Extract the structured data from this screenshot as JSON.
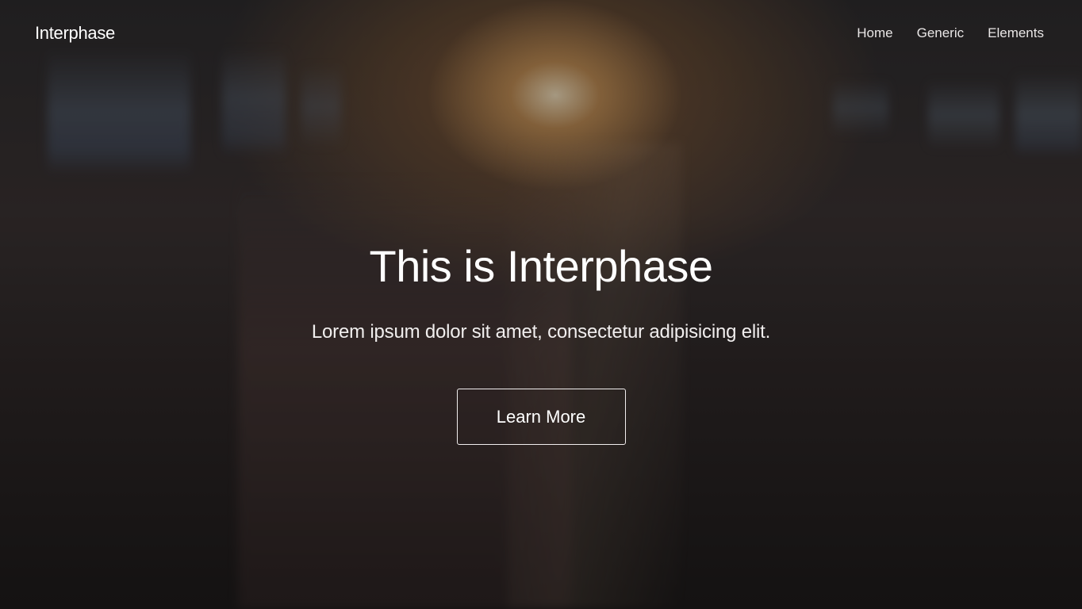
{
  "header": {
    "logo": "Interphase",
    "nav": [
      {
        "label": "Home"
      },
      {
        "label": "Generic"
      },
      {
        "label": "Elements"
      }
    ]
  },
  "hero": {
    "title": "This is Interphase",
    "subtitle": "Lorem ipsum dolor sit amet, consectetur adipisicing elit.",
    "button_label": "Learn More"
  },
  "colors": {
    "text": "#ffffff",
    "nav_text": "#e9e6e6",
    "button_border": "#f1eeee"
  }
}
